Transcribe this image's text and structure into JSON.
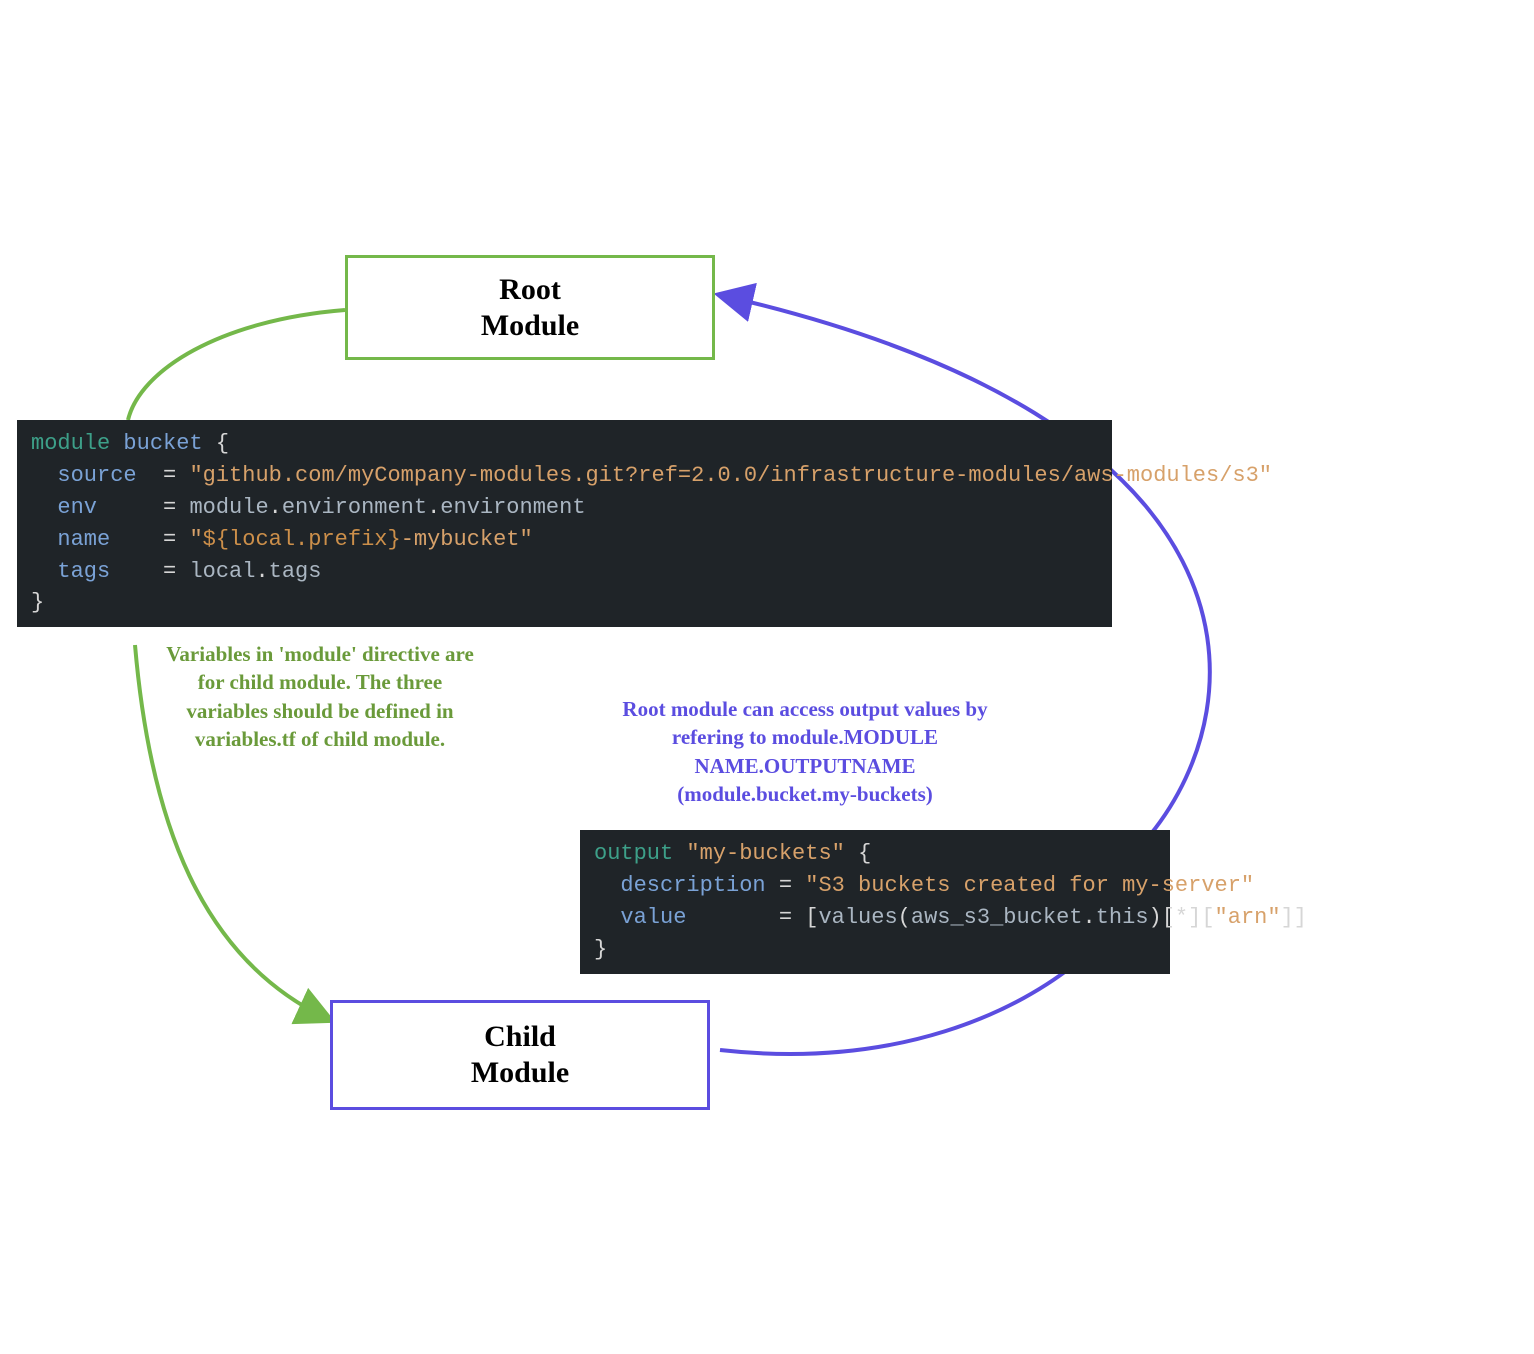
{
  "root_box": {
    "line1": "Root",
    "line2": "Module"
  },
  "child_box": {
    "line1": "Child",
    "line2": "Module"
  },
  "annotation_left": "Variables in 'module' directive are\nfor child module. The three\nvariables should be defined in\nvariables.tf of child module.",
  "annotation_right": "Root module can access output values by\nrefering to module.MODULE\nNAME.OUTPUTNAME\n(module.bucket.my-buckets)",
  "code_top": {
    "keyword": "module",
    "name": "bucket",
    "lines": [
      {
        "key": "source",
        "value_type": "string",
        "value": "\"github.com/myCompany-modules.git?ref=2.0.0/infrastructure-modules/aws-modules/s3\""
      },
      {
        "key": "env",
        "value_type": "expr",
        "value": "module.environment.environment"
      },
      {
        "key": "name",
        "value_type": "string_interp",
        "prefix": "\"",
        "interp": "${local.prefix}",
        "suffix": "-mybucket\""
      },
      {
        "key": "tags",
        "value_type": "expr",
        "value": "local.tags"
      }
    ]
  },
  "code_bottom": {
    "keyword": "output",
    "name": "\"my-buckets\"",
    "lines": [
      {
        "key": "description",
        "value_type": "string",
        "value": "\"S3 buckets created for my-server\""
      },
      {
        "key": "value",
        "value_type": "expr_mixed",
        "parts": [
          {
            "t": "punc",
            "v": "["
          },
          {
            "t": "pale",
            "v": "values"
          },
          {
            "t": "punc",
            "v": "("
          },
          {
            "t": "pale",
            "v": "aws_s3_bucket"
          },
          {
            "t": "punc",
            "v": "."
          },
          {
            "t": "pale",
            "v": "this"
          },
          {
            "t": "punc",
            "v": ")[*]["
          },
          {
            "t": "string",
            "v": "\"arn\""
          },
          {
            "t": "punc",
            "v": "]]"
          }
        ]
      }
    ]
  },
  "colors": {
    "green": "#74b84a",
    "purple": "#5b4de0",
    "code_bg": "#1f2428"
  }
}
